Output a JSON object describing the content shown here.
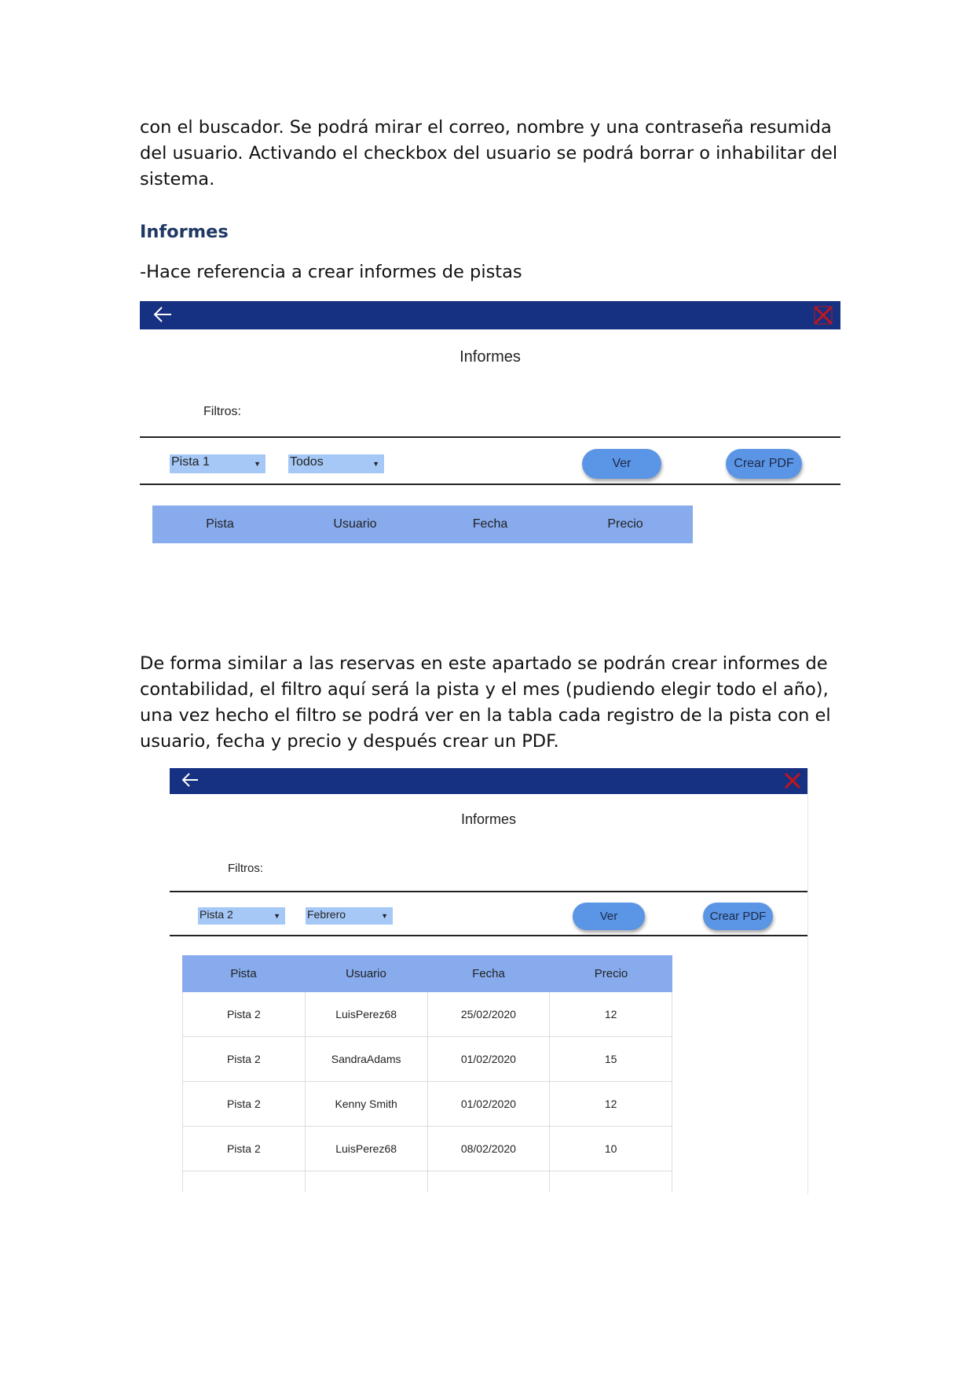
{
  "intro_paragraph": "con el buscador. Se podrá mirar el correo, nombre y una contraseña resumida del usuario. Activando el checkbox del usuario se podrá borrar o inhabilitar del sistema.",
  "section_heading": "Informes",
  "section_subtext": "-Hace referencia a crear informes de pistas",
  "description_paragraph": "De forma similar a las reservas en este apartado se podrán crear informes de contabilidad, el filtro aquí será la pista y el mes (pudiendo elegir todo el año), una vez hecho el filtro se podrá ver en la tabla cada registro de la pista con el usuario, fecha y precio y después crear un PDF.",
  "icons": {
    "back": "arrow-left-icon",
    "close": "close-icon"
  },
  "colors": {
    "topbar": "#163082",
    "select": "#a6c8f7",
    "button": "#5b95e5",
    "table_header": "#87abed",
    "heading": "#1f3864",
    "close": "#c0161d"
  },
  "mockup1": {
    "title": "Informes",
    "filters_label": "Filtros:",
    "select_pista": "Pista 1",
    "select_mes": "Todos",
    "ver_button": "Ver",
    "pdf_button": "Crear PDF",
    "columns": [
      "Pista",
      "Usuario",
      "Fecha",
      "Precio"
    ]
  },
  "mockup2": {
    "title": "Informes",
    "filters_label": "Filtros:",
    "select_pista": "Pista 2",
    "select_mes": "Febrero",
    "ver_button": "Ver",
    "pdf_button": "Crear PDF",
    "columns": [
      "Pista",
      "Usuario",
      "Fecha",
      "Precio"
    ],
    "rows": [
      [
        "Pista 2",
        "LuisPerez68",
        "25/02/2020",
        "12"
      ],
      [
        "Pista 2",
        "SandraAdams",
        "01/02/2020",
        "15"
      ],
      [
        "Pista 2",
        "Kenny Smith",
        "01/02/2020",
        "12"
      ],
      [
        "Pista 2",
        "LuisPerez68",
        "08/02/2020",
        "10"
      ]
    ]
  }
}
